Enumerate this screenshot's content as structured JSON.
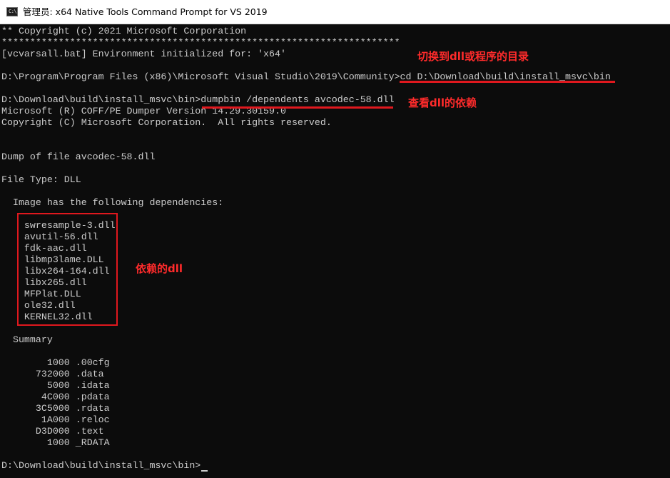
{
  "window": {
    "title": "管理员: x64 Native Tools Command Prompt for VS 2019",
    "icon": "cmd-icon",
    "icon_glyph": "C:\\"
  },
  "console": {
    "lines": [
      "** Copyright (c) 2021 Microsoft Corporation",
      "**********************************************************************",
      "[vcvarsall.bat] Environment initialized for: 'x64'",
      "",
      "D:\\Program\\Program Files (x86)\\Microsoft Visual Studio\\2019\\Community>cd D:\\Download\\build\\install_msvc\\bin",
      "",
      "D:\\Download\\build\\install_msvc\\bin>dumpbin /dependents avcodec-58.dll",
      "Microsoft (R) COFF/PE Dumper Version 14.29.30159.0",
      "Copyright (C) Microsoft Corporation.  All rights reserved.",
      "",
      "",
      "Dump of file avcodec-58.dll",
      "",
      "File Type: DLL",
      "",
      "  Image has the following dependencies:",
      "",
      "    swresample-3.dll",
      "    avutil-56.dll",
      "    fdk-aac.dll",
      "    libmp3lame.DLL",
      "    libx264-164.dll",
      "    libx265.dll",
      "    MFPlat.DLL",
      "    ole32.dll",
      "    KERNEL32.dll",
      "",
      "  Summary",
      "",
      "        1000 .00cfg",
      "      732000 .data",
      "        5000 .idata",
      "       4C000 .pdata",
      "      3C5000 .rdata",
      "       1A000 .reloc",
      "      D3D000 .text",
      "        1000 _RDATA",
      "",
      "D:\\Download\\build\\install_msvc\\bin>"
    ]
  },
  "annotations": {
    "switch_dir": "切换到dll或程序的目录",
    "check_deps": "查看dll的依赖",
    "dependent_dlls": "依赖的dll",
    "color": "#e0181e"
  }
}
